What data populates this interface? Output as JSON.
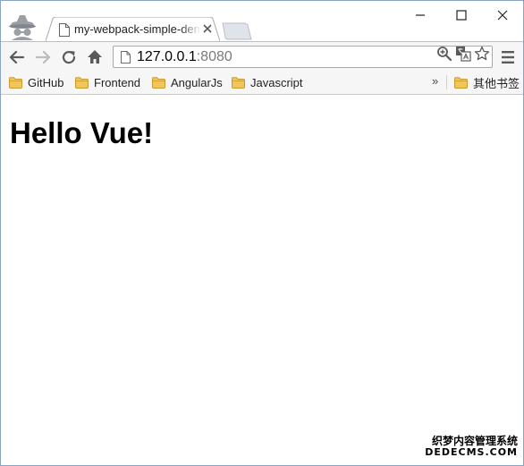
{
  "tab": {
    "title": "my-webpack-simple-demo"
  },
  "address_bar": {
    "host": "127.0.0.1",
    "port": ":8080"
  },
  "bookmarks": [
    {
      "label": "GitHub"
    },
    {
      "label": "Frontend"
    },
    {
      "label": "AngularJs"
    },
    {
      "label": "Javascript"
    }
  ],
  "bookmarks_overflow": "»",
  "other_bookmarks": "其他书签",
  "page": {
    "heading": "Hello Vue!"
  },
  "watermark": {
    "line1": "织梦内容管理系统",
    "line2": "DEDECMS.COM"
  },
  "colors": {
    "folder": "#f2c55c",
    "folder_border": "#c99a2e",
    "window_border": "#8aa4c4"
  }
}
